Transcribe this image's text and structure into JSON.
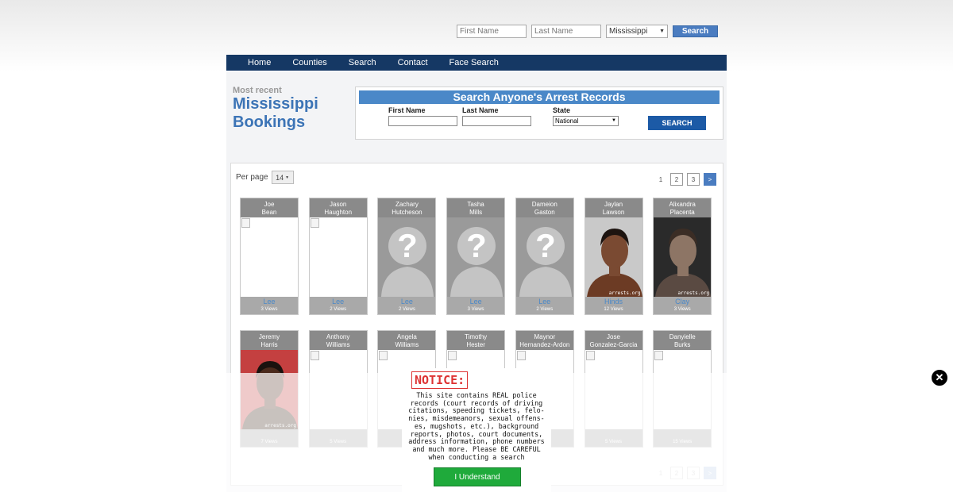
{
  "top_search": {
    "first_placeholder": "First Name",
    "last_placeholder": "Last Name",
    "state": "Mississippi",
    "button": "Search"
  },
  "nav": {
    "items": [
      "Home",
      "Counties",
      "Search",
      "Contact",
      "Face Search"
    ]
  },
  "heading": {
    "small": "Most recent",
    "line1": "Mississippi",
    "line2": "Bookings"
  },
  "search_box": {
    "title": "Search Anyone's Arrest Records",
    "first_label": "First Name",
    "last_label": "Last Name",
    "state_label": "State",
    "state_value": "National",
    "button": "SEARCH"
  },
  "per_page": {
    "label": "Per page",
    "value": "14"
  },
  "pagination": {
    "pages": [
      "1",
      "2",
      "3"
    ],
    "next": ">"
  },
  "bookings": [
    {
      "first": "Joe",
      "last": "Bean",
      "county": "Lee",
      "views": "3 Views",
      "photo": "broken"
    },
    {
      "first": "Jason",
      "last": "Haughton",
      "county": "Lee",
      "views": "2 Views",
      "photo": "broken"
    },
    {
      "first": "Zachary",
      "last": "Hutcheson",
      "county": "Lee",
      "views": "2 Views",
      "photo": "placeholder"
    },
    {
      "first": "Tasha",
      "last": "Mills",
      "county": "Lee",
      "views": "3 Views",
      "photo": "placeholder"
    },
    {
      "first": "Dameion",
      "last": "Gaston",
      "county": "Lee",
      "views": "2 Views",
      "photo": "placeholder"
    },
    {
      "first": "Jaylan",
      "last": "Lawson",
      "county": "Hinds",
      "views": "12 Views",
      "photo": "mugshot"
    },
    {
      "first": "Alixandra",
      "last": "Placenta",
      "county": "Clay",
      "views": "3 Views",
      "photo": "mugshot"
    },
    {
      "first": "Jeremy",
      "last": "Harris",
      "county": "",
      "views": "7 Views",
      "photo": "mugshot"
    },
    {
      "first": "Anthony",
      "last": "Williams",
      "county": "",
      "views": "5 Views",
      "photo": "broken"
    },
    {
      "first": "Angela",
      "last": "Williams",
      "county": "",
      "views": "",
      "photo": "broken"
    },
    {
      "first": "Timothy",
      "last": "Hester",
      "county": "",
      "views": "",
      "photo": "broken"
    },
    {
      "first": "Maynor",
      "last": "Hernandez-Ardon",
      "county": "",
      "views": "",
      "photo": "broken"
    },
    {
      "first": "Jose",
      "last": "Gonzalez-Garcia",
      "county": "",
      "views": "5 Views",
      "photo": "broken"
    },
    {
      "first": "Danyielle",
      "last": "Burks",
      "county": "",
      "views": "15 Views",
      "photo": "broken"
    }
  ],
  "watermark": "arrests.org",
  "notice": {
    "title": "NOTICE:",
    "lines": [
      "This site contains REAL police",
      "records (court records of driving",
      "citations, speeding tickets, felo-",
      "nies, misdemeanors, sexual offens-",
      "es, mugshots, etc.), background",
      "reports, photos, court documents,",
      "address information, phone numbers",
      "and much more. Please BE CAREFUL",
      "when conducting a search"
    ],
    "button": "I Understand"
  },
  "colors": {
    "nav": "#153864",
    "heading": "#3c74b6",
    "search_bar": "#4a88c8",
    "notice_red": "#dd3333",
    "ok_green": "#1faa3b"
  }
}
